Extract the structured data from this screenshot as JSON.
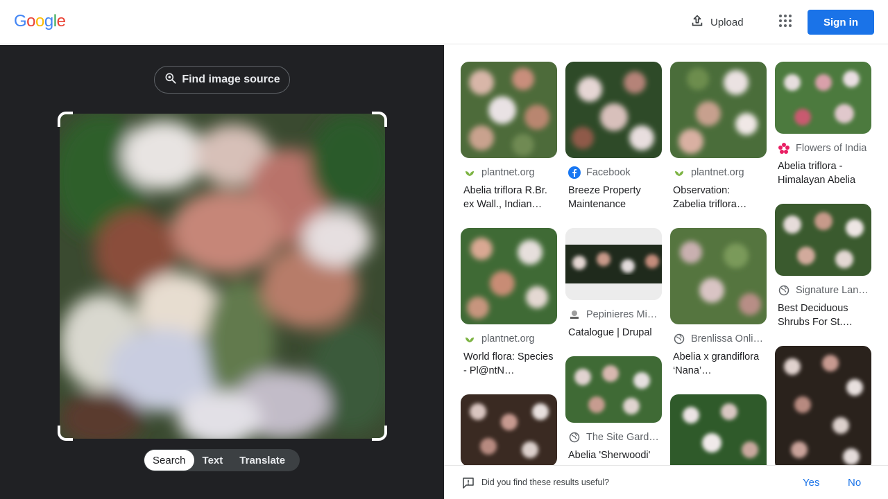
{
  "header": {
    "logo": "Google",
    "upload_label": "Upload",
    "signin_label": "Sign in",
    "icons": {
      "upload": "upload-icon",
      "apps": "apps-grid-icon"
    }
  },
  "lens": {
    "find_source_label": "Find image source",
    "modes": [
      "Search",
      "Text",
      "Translate"
    ],
    "active_mode": "Search"
  },
  "results": [
    {
      "source": "plantnet.org",
      "source_icon": "plantnet-icon",
      "title": "Abelia triflora R.Br. ex Wall., Indian…"
    },
    {
      "source": "Facebook",
      "source_icon": "facebook-icon",
      "title": "Breeze Property Maintenance"
    },
    {
      "source": "plantnet.org",
      "source_icon": "plantnet-icon",
      "title": "Observation: Zabelia triflora…"
    },
    {
      "source": "Flowers of India",
      "source_icon": "flowers-of-india-icon",
      "title": "Abelia triflora - Himalayan Abelia"
    },
    {
      "source": "plantnet.org",
      "source_icon": "plantnet-icon",
      "title": "World flora: Species - Pl@ntN…"
    },
    {
      "source": "Pepinieres Min…",
      "source_icon": "pepinieres-icon",
      "title": "Catalogue | Drupal"
    },
    {
      "source": "Brenlissa Onli…",
      "source_icon": "globe-icon",
      "title": "Abelia x grandiflora ‘Nana’…"
    },
    {
      "source": "Signature Lan…",
      "source_icon": "globe-icon",
      "title": "Best Deciduous Shrubs For St.…"
    },
    {
      "source": "The Site Garde…",
      "source_icon": "globe-icon",
      "title": "Abelia 'Sherwoodi'"
    }
  ],
  "feedback": {
    "question": "Did you find these results useful?",
    "yes": "Yes",
    "no": "No"
  },
  "colors": {
    "accent": "#1a73e8",
    "left_bg": "#202124",
    "text": "#202124",
    "muted": "#5f6368"
  }
}
